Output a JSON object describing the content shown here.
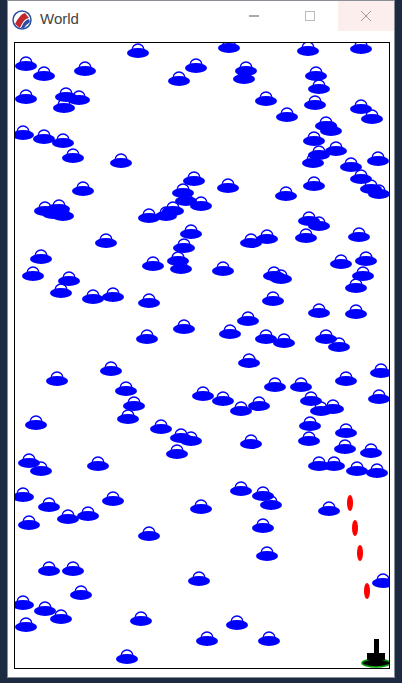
{
  "window": {
    "title": "World"
  }
}
